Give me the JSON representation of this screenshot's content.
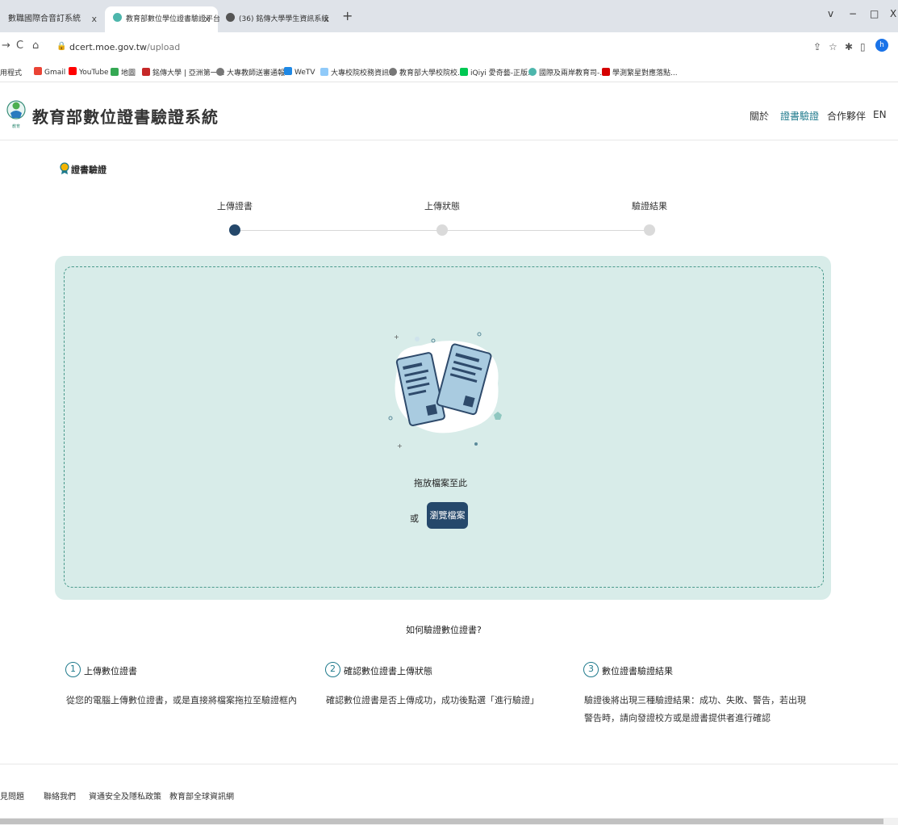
{
  "browser": {
    "tabs": [
      {
        "label": "數職國際合音訂系統",
        "close": "x"
      },
      {
        "label": "教育部數位學位證書驗證平台",
        "close": "x"
      },
      {
        "label": "(36) 銘傳大學學生資訊系統",
        "close": "x"
      }
    ],
    "new_tab": "+",
    "window_controls": [
      "v",
      "−",
      "□",
      "X"
    ],
    "nav": {
      "back": "→",
      "reload": "C",
      "home": "⌂"
    },
    "url_host": "dcert.moe.gov.tw",
    "url_path": "/upload",
    "profile_initial": "h",
    "bookmarks": [
      {
        "label": "用程式",
        "color": "#4a4a4a"
      },
      {
        "label": "Gmail",
        "color": "#ea4335"
      },
      {
        "label": "YouTube",
        "color": "#ff0000"
      },
      {
        "label": "地圖",
        "color": "#34a853"
      },
      {
        "label": "銘傳大學 | 亞洲第一...",
        "color": "#c62828"
      },
      {
        "label": "大專教師送審通報...",
        "color": "#777777"
      },
      {
        "label": "WeTV",
        "color": "#1e88e5"
      },
      {
        "label": "大專校院校務資訊...",
        "color": "#90caf9"
      },
      {
        "label": "教育部大學校院校...",
        "color": "#777777"
      },
      {
        "label": "iQiyi 愛奇藝-正版...",
        "color": "#00c853"
      },
      {
        "label": "國際及兩岸教育司-...",
        "color": "#4db6ac"
      },
      {
        "label": "學測繁星對應落點...",
        "color": "#d50000"
      }
    ]
  },
  "header": {
    "title": "教育部數位證書驗證系統",
    "nav": [
      "關於",
      "證書驗證",
      "合作夥伴",
      "EN"
    ]
  },
  "section_title": "證書驗證",
  "steps": [
    "上傳證書",
    "上傳狀態",
    "驗證結果"
  ],
  "upload": {
    "drop_text": "拖放檔案至此",
    "or_text": "或",
    "browse_label": "瀏覽檔案"
  },
  "howto": {
    "title": "如何驗證數位證書?",
    "items": [
      {
        "num": "1",
        "head": "上傳數位證書",
        "desc": "從您的電腦上傳數位證書，或是直接將檔案拖拉至驗證框內"
      },
      {
        "num": "2",
        "head": "確認數位證書上傳狀態",
        "desc": "確認數位證書是否上傳成功，成功後點選「進行驗證」"
      },
      {
        "num": "3",
        "head": "數位證書驗證結果",
        "desc": "驗證後將出現三種驗證結果：成功、失敗、警告，若出現警告時，請向發證校方或是證書提供者進行確認"
      }
    ]
  },
  "footer": [
    "見問題",
    "聯絡我們",
    "資通安全及隱私政策",
    "教育部全球資訊網"
  ],
  "colors": {
    "primary": "#25486b",
    "accent": "#1f7a8c",
    "dropzone_bg": "#d8ece9"
  }
}
